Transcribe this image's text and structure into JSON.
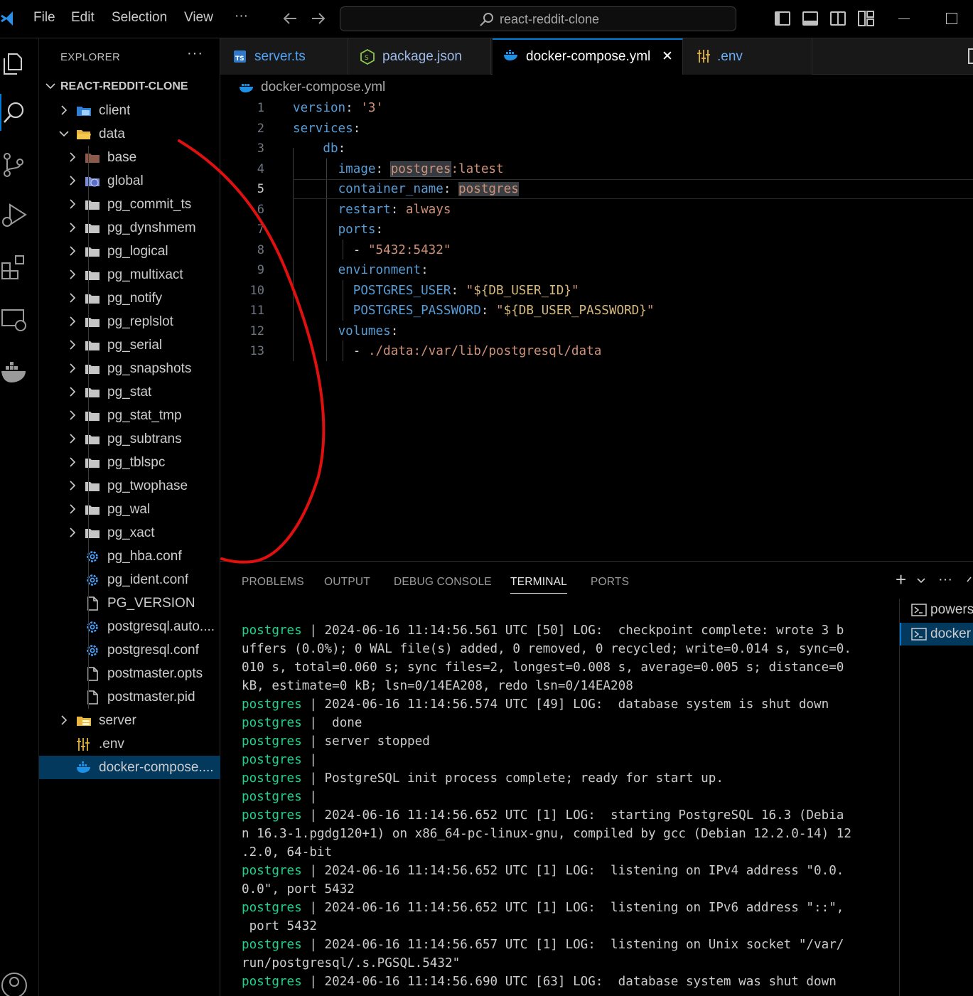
{
  "menu": {
    "file": "File",
    "edit": "Edit",
    "selection": "Selection",
    "view": "View",
    "more": "···"
  },
  "search": {
    "label": "react-reddit-clone"
  },
  "sidebar": {
    "title": "EXPLORER",
    "more": "···",
    "root": "REACT-REDDIT-CLONE",
    "items": [
      {
        "label": "client",
        "kind": "folder-client",
        "depth": 1,
        "chevron": "right"
      },
      {
        "label": "data",
        "kind": "folder-data-open",
        "depth": 1,
        "chevron": "down"
      },
      {
        "label": "base",
        "kind": "folder-base",
        "depth": 2,
        "chevron": "right"
      },
      {
        "label": "global",
        "kind": "folder-global",
        "depth": 2,
        "chevron": "right"
      },
      {
        "label": "pg_commit_ts",
        "kind": "folder",
        "depth": 2,
        "chevron": "right"
      },
      {
        "label": "pg_dynshmem",
        "kind": "folder",
        "depth": 2,
        "chevron": "right"
      },
      {
        "label": "pg_logical",
        "kind": "folder",
        "depth": 2,
        "chevron": "right"
      },
      {
        "label": "pg_multixact",
        "kind": "folder",
        "depth": 2,
        "chevron": "right"
      },
      {
        "label": "pg_notify",
        "kind": "folder",
        "depth": 2,
        "chevron": "right"
      },
      {
        "label": "pg_replslot",
        "kind": "folder",
        "depth": 2,
        "chevron": "right"
      },
      {
        "label": "pg_serial",
        "kind": "folder",
        "depth": 2,
        "chevron": "right"
      },
      {
        "label": "pg_snapshots",
        "kind": "folder",
        "depth": 2,
        "chevron": "right"
      },
      {
        "label": "pg_stat",
        "kind": "folder",
        "depth": 2,
        "chevron": "right"
      },
      {
        "label": "pg_stat_tmp",
        "kind": "folder",
        "depth": 2,
        "chevron": "right"
      },
      {
        "label": "pg_subtrans",
        "kind": "folder",
        "depth": 2,
        "chevron": "right"
      },
      {
        "label": "pg_tblspc",
        "kind": "folder",
        "depth": 2,
        "chevron": "right"
      },
      {
        "label": "pg_twophase",
        "kind": "folder",
        "depth": 2,
        "chevron": "right"
      },
      {
        "label": "pg_wal",
        "kind": "folder",
        "depth": 2,
        "chevron": "right"
      },
      {
        "label": "pg_xact",
        "kind": "folder",
        "depth": 2,
        "chevron": "right"
      },
      {
        "label": "pg_hba.conf",
        "kind": "gear",
        "depth": 2,
        "chevron": ""
      },
      {
        "label": "pg_ident.conf",
        "kind": "gear",
        "depth": 2,
        "chevron": ""
      },
      {
        "label": "PG_VERSION",
        "kind": "file",
        "depth": 2,
        "chevron": ""
      },
      {
        "label": "postgresql.auto....",
        "kind": "gear",
        "depth": 2,
        "chevron": ""
      },
      {
        "label": "postgresql.conf",
        "kind": "gear",
        "depth": 2,
        "chevron": ""
      },
      {
        "label": "postmaster.opts",
        "kind": "file",
        "depth": 2,
        "chevron": ""
      },
      {
        "label": "postmaster.pid",
        "kind": "file",
        "depth": 2,
        "chevron": ""
      },
      {
        "label": "server",
        "kind": "folder-server",
        "depth": 1,
        "chevron": "right"
      },
      {
        "label": ".env",
        "kind": "env",
        "depth": 1,
        "chevron": ""
      },
      {
        "label": "docker-compose....",
        "kind": "docker",
        "depth": 1,
        "chevron": "",
        "selected": true
      }
    ]
  },
  "tabs": [
    {
      "label": "server.ts",
      "icon": "ts",
      "color": "#4fa3f7"
    },
    {
      "label": "package.json",
      "icon": "node",
      "color": "#9cb8e9"
    },
    {
      "label": "docker-compose.yml",
      "icon": "docker",
      "color": "#ffffff",
      "active": true,
      "close": "✕"
    },
    {
      "label": ".env",
      "icon": "env",
      "color": "#6aaef7"
    }
  ],
  "breadcrumb": {
    "file": "docker-compose.yml"
  },
  "code": {
    "lines": [
      "1",
      "2",
      "3",
      "4",
      "5",
      "6",
      "7",
      "8",
      "9",
      "10",
      "11",
      "12",
      "13"
    ],
    "l1_key": "version",
    "l1_val": "'3'",
    "l2_key": "services",
    "l3_key": "db",
    "l4_key": "image",
    "l4_val_a": "postgres",
    "l4_val_b": ":latest",
    "l5_key": "container_name",
    "l5_val": "postgres",
    "l6_key": "restart",
    "l6_val": "always",
    "l7_key": "ports",
    "l8_val": "\"5432:5432\"",
    "l9_key": "environment",
    "l10_key": "POSTGRES_USER",
    "l10_q": "\"",
    "l10_var": "${DB_USER_ID}",
    "l11_key": "POSTGRES_PASSWORD",
    "l11_var": "${DB_USER_PASSWORD}",
    "l12_key": "volumes",
    "l13_val": "./data:/var/lib/postgresql/data",
    "colon": ":",
    "dash": "-"
  },
  "panel": {
    "tabs": [
      "PROBLEMS",
      "OUTPUT",
      "DEBUG CONSOLE",
      "TERMINAL",
      "PORTS"
    ],
    "active_tab": "TERMINAL",
    "add": "+",
    "more": "···",
    "terminals": [
      "powershell",
      "docker"
    ],
    "log": [
      {
        "p": "postgres",
        "t": " | 2024-06-16 11:14:56.561 UTC [50] LOG:  checkpoint complete: wrote 3 b"
      },
      {
        "p": "",
        "t": "uffers (0.0%); 0 WAL file(s) added, 0 removed, 0 recycled; write=0.014 s, sync=0."
      },
      {
        "p": "",
        "t": "010 s, total=0.060 s; sync files=2, longest=0.008 s, average=0.005 s; distance=0"
      },
      {
        "p": "",
        "t": "kB, estimate=0 kB; lsn=0/14EA208, redo lsn=0/14EA208"
      },
      {
        "p": "postgres",
        "t": " | 2024-06-16 11:14:56.574 UTC [49] LOG:  database system is shut down"
      },
      {
        "p": "postgres",
        "t": " |  done"
      },
      {
        "p": "postgres",
        "t": " | server stopped"
      },
      {
        "p": "postgres",
        "t": " |"
      },
      {
        "p": "postgres",
        "t": " | PostgreSQL init process complete; ready for start up."
      },
      {
        "p": "postgres",
        "t": " |"
      },
      {
        "p": "postgres",
        "t": " | 2024-06-16 11:14:56.652 UTC [1] LOG:  starting PostgreSQL 16.3 (Debia"
      },
      {
        "p": "",
        "t": "n 16.3-1.pgdg120+1) on x86_64-pc-linux-gnu, compiled by gcc (Debian 12.2.0-14) 12"
      },
      {
        "p": "",
        "t": ".2.0, 64-bit"
      },
      {
        "p": "postgres",
        "t": " | 2024-06-16 11:14:56.652 UTC [1] LOG:  listening on IPv4 address \"0.0."
      },
      {
        "p": "",
        "t": "0.0\", port 5432"
      },
      {
        "p": "postgres",
        "t": " | 2024-06-16 11:14:56.652 UTC [1] LOG:  listening on IPv6 address \"::\","
      },
      {
        "p": "",
        "t": " port 5432"
      },
      {
        "p": "postgres",
        "t": " | 2024-06-16 11:14:56.657 UTC [1] LOG:  listening on Unix socket \"/var/"
      },
      {
        "p": "",
        "t": "run/postgresql/.s.PGSQL.5432\""
      },
      {
        "p": "postgres",
        "t": " | 2024-06-16 11:14:56.690 UTC [63] LOG:  database system was shut down"
      }
    ]
  },
  "colors": {
    "accent": "#0078d4",
    "terminal_prefix": "#23d18b",
    "annotation": "#e01010"
  }
}
